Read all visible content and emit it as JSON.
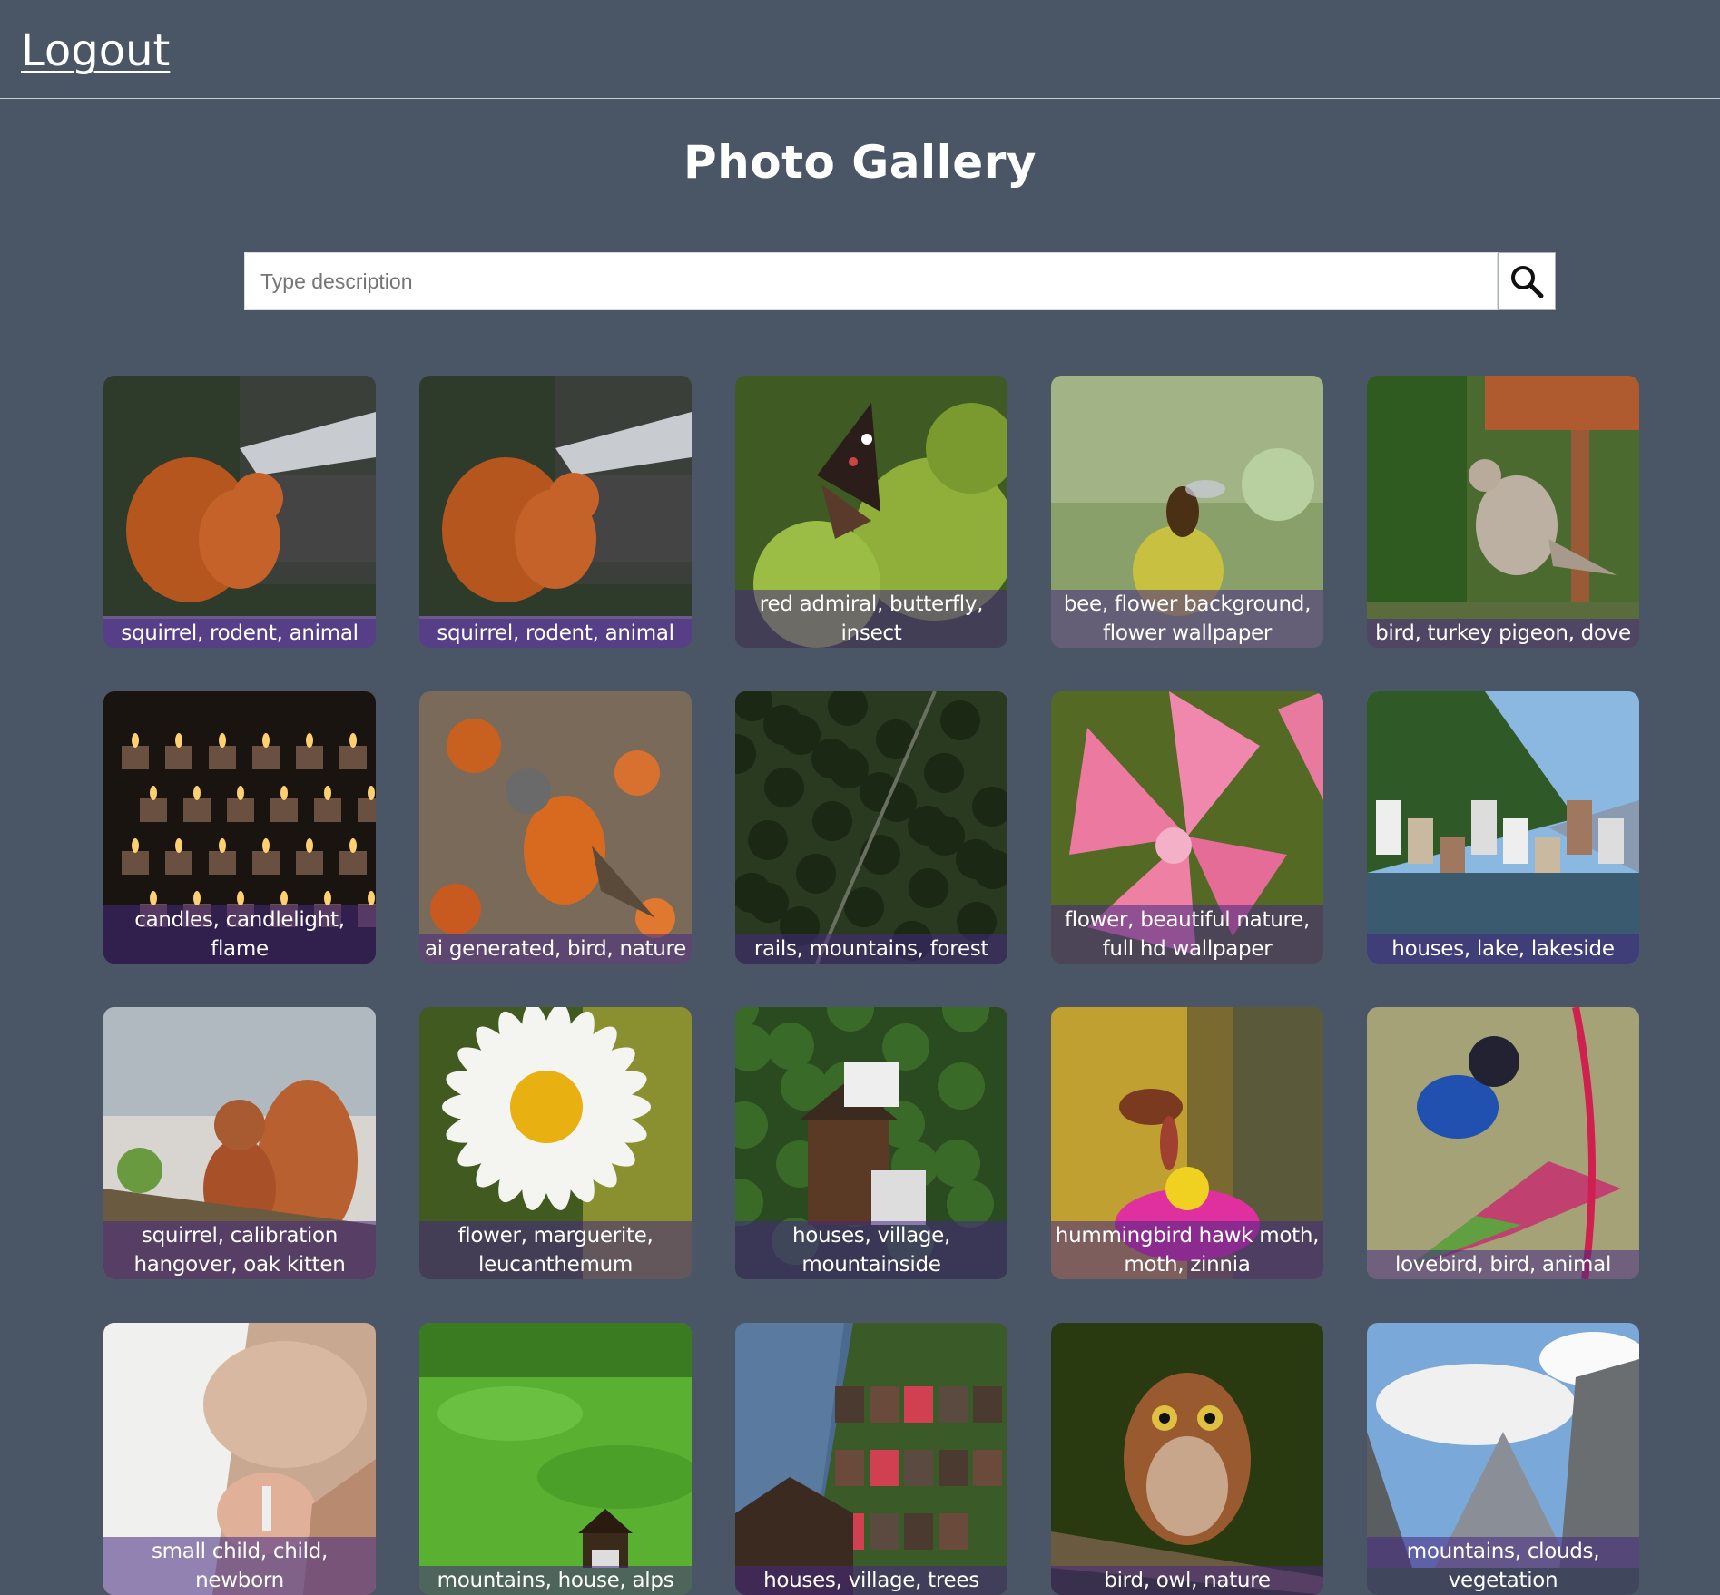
{
  "header": {
    "logout_label": "Logout"
  },
  "page": {
    "title": "Photo Gallery"
  },
  "search": {
    "placeholder": "Type description",
    "value": "",
    "button_icon": "search-icon"
  },
  "gallery": {
    "items": [
      {
        "caption": "squirrel, rodent, animal",
        "scene": "squirrel"
      },
      {
        "caption": "squirrel, rodent, animal",
        "scene": "squirrel"
      },
      {
        "caption": "red admiral, butterfly, insect",
        "scene": "butterfly"
      },
      {
        "caption": "bee, flower background, flower wallpaper",
        "scene": "bee"
      },
      {
        "caption": "bird, turkey pigeon, dove",
        "scene": "dove"
      },
      {
        "caption": "candles, candlelight, flame",
        "scene": "candles"
      },
      {
        "caption": "ai generated, bird, nature",
        "scene": "robin"
      },
      {
        "caption": "rails, mountains, forest",
        "scene": "forest"
      },
      {
        "caption": "flower, beautiful nature, full hd wallpaper",
        "scene": "pinkflower"
      },
      {
        "caption": "houses, lake, lakeside",
        "scene": "lake"
      },
      {
        "caption": "squirrel, calibration hangover, oak kitten",
        "scene": "squirrel2"
      },
      {
        "caption": "flower, marguerite, leucanthemum",
        "scene": "daisy"
      },
      {
        "caption": "houses, village, mountainside",
        "scene": "village"
      },
      {
        "caption": "hummingbird hawk moth, moth, zinnia",
        "scene": "moth"
      },
      {
        "caption": "lovebird, bird, animal",
        "scene": "lovebird"
      },
      {
        "caption": "small child, child, newborn",
        "scene": "baby"
      },
      {
        "caption": "mountains, house, alps",
        "scene": "alps"
      },
      {
        "caption": "houses, village, trees",
        "scene": "village2"
      },
      {
        "caption": "bird, owl, nature",
        "scene": "owl"
      },
      {
        "caption": "mountains, clouds, vegetation",
        "scene": "clouds"
      }
    ]
  },
  "colors": {
    "background": "#4a5566",
    "caption_overlay": "#46288280",
    "divider": "#c9ced6"
  }
}
